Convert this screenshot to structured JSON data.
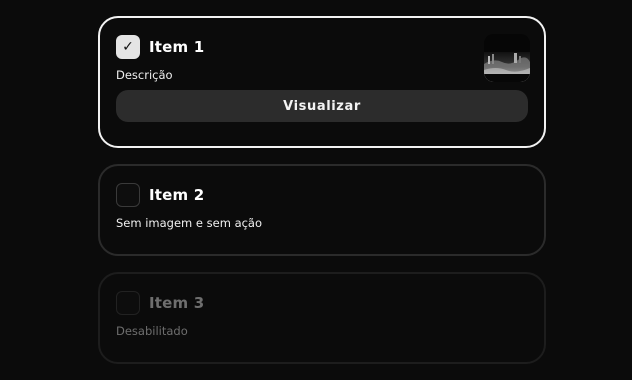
{
  "items": [
    {
      "title": "Item 1",
      "description": "Descrição",
      "checked": true,
      "check_mark": "✓",
      "has_image": true,
      "action_label": "Visualizar"
    },
    {
      "title": "Item 2",
      "description": "Sem imagem e sem ação",
      "checked": false,
      "has_image": false
    },
    {
      "title": "Item 3",
      "description": "Desabilitado",
      "checked": false,
      "disabled": true,
      "has_image": false
    }
  ],
  "colors": {
    "background": "#0b0b0b",
    "selected_border": "#f2f2f2",
    "card_border": "#2b2b2b",
    "button_bg": "#2c2c2c",
    "disabled_text": "#6e6e6e"
  }
}
